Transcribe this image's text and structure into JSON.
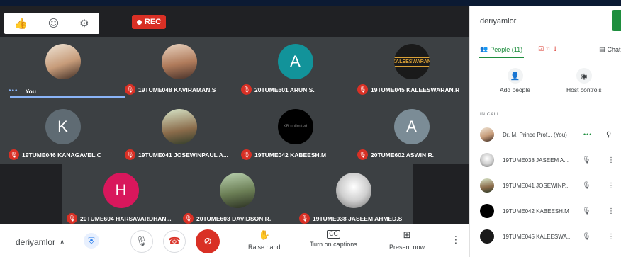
{
  "recording": {
    "label": "REC"
  },
  "reactions": [
    "thumbs-up-icon",
    "clapping-icon",
    "gear-icon"
  ],
  "tiles": {
    "you": "You",
    "t2": "19TUME048 KAVIRAMAN.S",
    "t3": "20TUME601 ARUN S.",
    "t4": "19TUME045 KALEESWARAN.R",
    "t5": "19TUME046 KANAGAVEL.C",
    "t6": "19TUME041 JOSEWINPAUL A...",
    "t7": "19TUME042 KABEESH.M",
    "t8": "20TUME602 ASWIN R.",
    "t9": "20TUME604 HARSAVARDHAN...",
    "t10": "20TUME603 DAVIDSON R.",
    "t11": "19TUME038 JASEEM AHMED.S",
    "initials": {
      "t3": "A",
      "t5": "K",
      "t8": "A",
      "t9": "H"
    },
    "logo_text": {
      "t4": "KALEESWARAN",
      "t7": "KB unlimited"
    }
  },
  "colors": {
    "arun": "#12939a",
    "kanagavel": "#5f6b73",
    "aswin": "#7b8c96",
    "harsa": "#d8175c",
    "accent": "#1e8e3e",
    "danger": "#d93025"
  },
  "bottom": {
    "meeting_code": "deriyamlor",
    "raise_hand": "Raise hand",
    "captions": "Turn on captions",
    "present": "Present now"
  },
  "panel": {
    "title": "deriyamlor",
    "people_tab": "People (11)",
    "tasks_badge": "11",
    "chat_tab": "Chat",
    "add_people": "Add people",
    "host_controls": "Host controls",
    "in_call": "IN CALL",
    "participants": [
      "Dr. M. Prince Prof...  (You)",
      "19TUME038 JASEEM A...",
      "19TUME041 JOSEWINP...",
      "19TUME042 KABEESH.M",
      "19TUME045 KALEESWA..."
    ]
  }
}
